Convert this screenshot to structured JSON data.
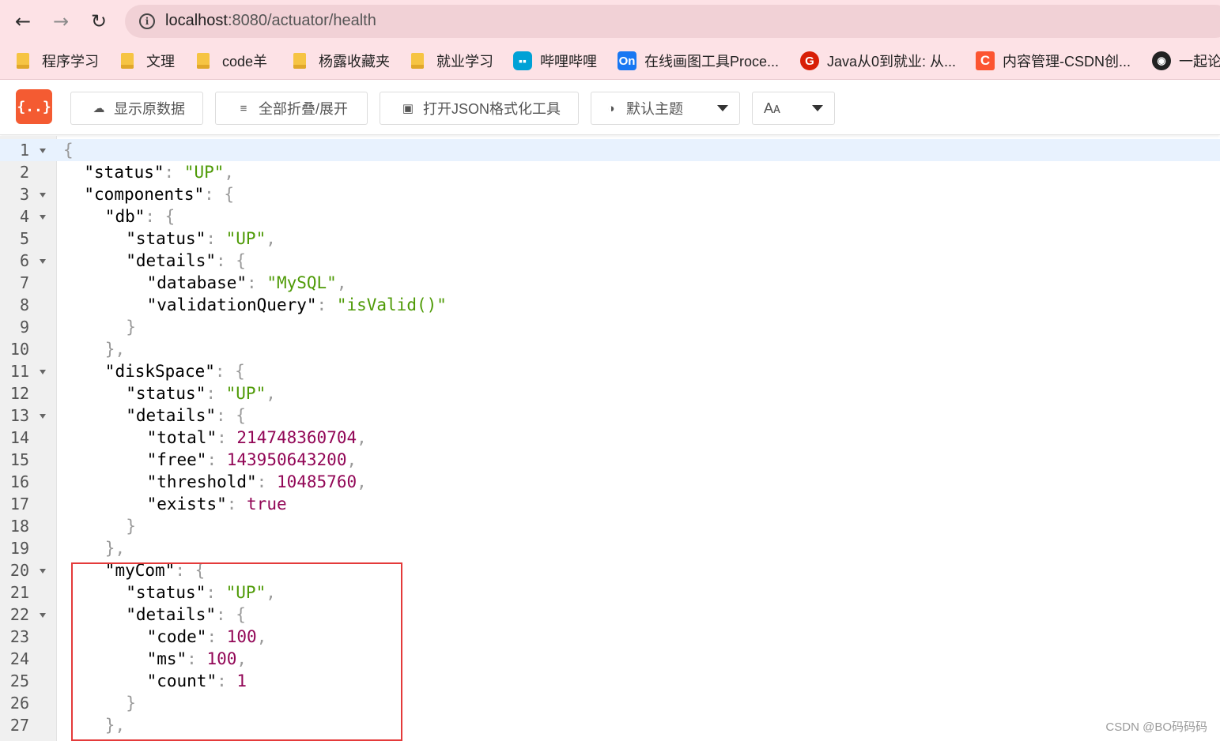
{
  "browser": {
    "back_icon": "arrow-left-icon",
    "forward_icon": "arrow-right-icon",
    "reload_icon": "reload-icon",
    "site_info_icon": "info-icon",
    "url_host": "localhost",
    "url_path": ":8080/actuator/health"
  },
  "bookmarks": [
    {
      "label": "程序学习",
      "icon": "folder-icon"
    },
    {
      "label": "文理",
      "icon": "folder-icon"
    },
    {
      "label": "code羊",
      "icon": "folder-icon"
    },
    {
      "label": "杨露收藏夹",
      "icon": "folder-icon"
    },
    {
      "label": "就业学习",
      "icon": "folder-icon"
    },
    {
      "label": "哔哩哔哩",
      "icon": "bilibili-icon"
    },
    {
      "label": "在线画图工具Proce...",
      "icon": "processon-icon",
      "icon_text": "On"
    },
    {
      "label": "Java从0到就业: 从...",
      "icon": "java-icon",
      "icon_text": "G"
    },
    {
      "label": "内容管理-CSDN创...",
      "icon": "csdn-icon",
      "icon_text": "C"
    },
    {
      "label": "一起论",
      "icon": "globe-icon"
    }
  ],
  "toolbar": {
    "logo_text": "{..}",
    "raw_label": "显示原数据",
    "fold_label": "全部折叠/展开",
    "format_label": "打开JSON格式化工具",
    "theme_label": "默认主题",
    "font_label": "Aᴀ"
  },
  "editor": {
    "lines": [
      {
        "n": "1",
        "fold": true,
        "indent": 0,
        "tokens": [
          [
            "p",
            "{"
          ]
        ]
      },
      {
        "n": "2",
        "fold": false,
        "indent": 1,
        "tokens": [
          [
            "k",
            "\"status\""
          ],
          [
            "p",
            ": "
          ],
          [
            "s",
            "\"UP\""
          ],
          [
            "p",
            ","
          ]
        ]
      },
      {
        "n": "3",
        "fold": true,
        "indent": 1,
        "tokens": [
          [
            "k",
            "\"components\""
          ],
          [
            "p",
            ": {"
          ]
        ]
      },
      {
        "n": "4",
        "fold": true,
        "indent": 2,
        "tokens": [
          [
            "k",
            "\"db\""
          ],
          [
            "p",
            ": {"
          ]
        ]
      },
      {
        "n": "5",
        "fold": false,
        "indent": 3,
        "tokens": [
          [
            "k",
            "\"status\""
          ],
          [
            "p",
            ": "
          ],
          [
            "s",
            "\"UP\""
          ],
          [
            "p",
            ","
          ]
        ]
      },
      {
        "n": "6",
        "fold": true,
        "indent": 3,
        "tokens": [
          [
            "k",
            "\"details\""
          ],
          [
            "p",
            ": {"
          ]
        ]
      },
      {
        "n": "7",
        "fold": false,
        "indent": 4,
        "tokens": [
          [
            "k",
            "\"database\""
          ],
          [
            "p",
            ": "
          ],
          [
            "s",
            "\"MySQL\""
          ],
          [
            "p",
            ","
          ]
        ]
      },
      {
        "n": "8",
        "fold": false,
        "indent": 4,
        "tokens": [
          [
            "k",
            "\"validationQuery\""
          ],
          [
            "p",
            ": "
          ],
          [
            "s",
            "\"isValid()\""
          ]
        ]
      },
      {
        "n": "9",
        "fold": false,
        "indent": 3,
        "tokens": [
          [
            "p",
            "}"
          ]
        ]
      },
      {
        "n": "10",
        "fold": false,
        "indent": 2,
        "tokens": [
          [
            "p",
            "},"
          ]
        ]
      },
      {
        "n": "11",
        "fold": true,
        "indent": 2,
        "tokens": [
          [
            "k",
            "\"diskSpace\""
          ],
          [
            "p",
            ": {"
          ]
        ]
      },
      {
        "n": "12",
        "fold": false,
        "indent": 3,
        "tokens": [
          [
            "k",
            "\"status\""
          ],
          [
            "p",
            ": "
          ],
          [
            "s",
            "\"UP\""
          ],
          [
            "p",
            ","
          ]
        ]
      },
      {
        "n": "13",
        "fold": true,
        "indent": 3,
        "tokens": [
          [
            "k",
            "\"details\""
          ],
          [
            "p",
            ": {"
          ]
        ]
      },
      {
        "n": "14",
        "fold": false,
        "indent": 4,
        "tokens": [
          [
            "k",
            "\"total\""
          ],
          [
            "p",
            ": "
          ],
          [
            "n",
            "214748360704"
          ],
          [
            "p",
            ","
          ]
        ]
      },
      {
        "n": "15",
        "fold": false,
        "indent": 4,
        "tokens": [
          [
            "k",
            "\"free\""
          ],
          [
            "p",
            ": "
          ],
          [
            "n",
            "143950643200"
          ],
          [
            "p",
            ","
          ]
        ]
      },
      {
        "n": "16",
        "fold": false,
        "indent": 4,
        "tokens": [
          [
            "k",
            "\"threshold\""
          ],
          [
            "p",
            ": "
          ],
          [
            "n",
            "10485760"
          ],
          [
            "p",
            ","
          ]
        ]
      },
      {
        "n": "17",
        "fold": false,
        "indent": 4,
        "tokens": [
          [
            "k",
            "\"exists\""
          ],
          [
            "p",
            ": "
          ],
          [
            "b",
            "true"
          ]
        ]
      },
      {
        "n": "18",
        "fold": false,
        "indent": 3,
        "tokens": [
          [
            "p",
            "}"
          ]
        ]
      },
      {
        "n": "19",
        "fold": false,
        "indent": 2,
        "tokens": [
          [
            "p",
            "},"
          ]
        ]
      },
      {
        "n": "20",
        "fold": true,
        "indent": 2,
        "tokens": [
          [
            "k",
            "\"myCom\""
          ],
          [
            "p",
            ": {"
          ]
        ]
      },
      {
        "n": "21",
        "fold": false,
        "indent": 3,
        "tokens": [
          [
            "k",
            "\"status\""
          ],
          [
            "p",
            ": "
          ],
          [
            "s",
            "\"UP\""
          ],
          [
            "p",
            ","
          ]
        ]
      },
      {
        "n": "22",
        "fold": true,
        "indent": 3,
        "tokens": [
          [
            "k",
            "\"details\""
          ],
          [
            "p",
            ": {"
          ]
        ]
      },
      {
        "n": "23",
        "fold": false,
        "indent": 4,
        "tokens": [
          [
            "k",
            "\"code\""
          ],
          [
            "p",
            ": "
          ],
          [
            "n",
            "100"
          ],
          [
            "p",
            ","
          ]
        ]
      },
      {
        "n": "24",
        "fold": false,
        "indent": 4,
        "tokens": [
          [
            "k",
            "\"ms\""
          ],
          [
            "p",
            ": "
          ],
          [
            "n",
            "100"
          ],
          [
            "p",
            ","
          ]
        ]
      },
      {
        "n": "25",
        "fold": false,
        "indent": 4,
        "tokens": [
          [
            "k",
            "\"count\""
          ],
          [
            "p",
            ": "
          ],
          [
            "n",
            "1"
          ]
        ]
      },
      {
        "n": "26",
        "fold": false,
        "indent": 3,
        "tokens": [
          [
            "p",
            "}"
          ]
        ]
      },
      {
        "n": "27",
        "fold": false,
        "indent": 2,
        "tokens": [
          [
            "p",
            "},"
          ]
        ]
      }
    ]
  },
  "colors": {
    "key": "#000000",
    "string": "#4e9a06",
    "number": "#920757",
    "punctuation": "#9a9a9a",
    "highlight_box": "#e43a3a",
    "logo": "#f45b32"
  },
  "watermark": "CSDN @BO码码码"
}
